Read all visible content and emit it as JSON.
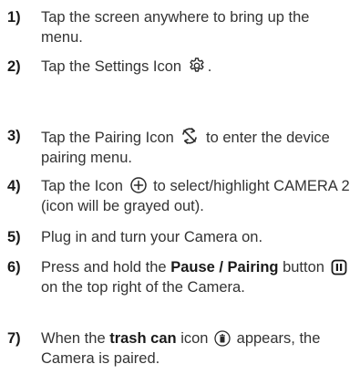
{
  "steps": [
    {
      "number": "1)",
      "text_a": "Tap the screen anywhere to bring up the menu."
    },
    {
      "number": "2)",
      "text_a": "Tap the Settings Icon",
      "text_b": ".",
      "icon": "gear-icon"
    },
    {
      "number": "3)",
      "text_a": "Tap the Pairing Icon",
      "text_b": "to enter the device pairing menu.",
      "icon": "pairing-arrows-icon"
    },
    {
      "number": "4)",
      "text_a": "Tap the Icon",
      "text_b": "to select/highlight CAMERA 2 (icon will be grayed out).",
      "icon": "plus-circle-icon"
    },
    {
      "number": "5)",
      "text_a": "Plug in and turn your Camera on."
    },
    {
      "number": "6)",
      "text_a": "Press and hold the",
      "bold": "Pause / Pairing",
      "text_b": "button",
      "text_c": "on the top right of the Camera.",
      "icon": "pause-button-icon"
    },
    {
      "number": "7)",
      "text_a": "When the",
      "bold": "trash can",
      "text_b": "icon",
      "text_c": "appears, the Camera is paired.",
      "icon": "trash-can-icon"
    }
  ]
}
